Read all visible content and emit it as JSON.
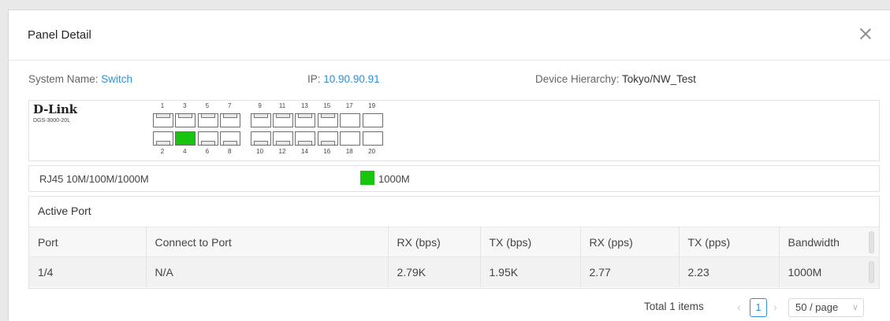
{
  "dialog": {
    "title": "Panel Detail"
  },
  "system": {
    "name_label": "System Name:",
    "name_value": "Switch",
    "ip_label": "IP:",
    "ip_value": "10.90.90.91",
    "hierarchy_label": "Device Hierarchy:",
    "hierarchy_value": "Tokyo/NW_Test"
  },
  "device": {
    "brand": "D-Link",
    "model": "DGS-3000-20L",
    "top_ports": [
      "1",
      "3",
      "5",
      "7",
      "9",
      "11",
      "13",
      "15",
      "17",
      "19"
    ],
    "bottom_ports": [
      "2",
      "4",
      "6",
      "8",
      "10",
      "12",
      "14",
      "16",
      "18",
      "20"
    ],
    "active_ports": [
      "4"
    ],
    "active_color": "#18c40e"
  },
  "legend": {
    "port_type": "RJ45 10M/100M/1000M",
    "speed_label": "1000M"
  },
  "active_port": {
    "title": "Active Port",
    "columns": [
      "Port",
      "Connect to Port",
      "RX (bps)",
      "TX (bps)",
      "RX (pps)",
      "TX (pps)",
      "Bandwidth"
    ],
    "rows": [
      [
        "1/4",
        "N/A",
        "2.79K",
        "1.95K",
        "2.77",
        "2.23",
        "1000M"
      ]
    ]
  },
  "pagination": {
    "total": "Total 1 items",
    "current_page": "1",
    "prev_icon": "‹",
    "next_icon": "›",
    "page_size": "50 / page"
  },
  "colors": {
    "link": "#2f8fd6",
    "accent": "#2f8fd6"
  }
}
